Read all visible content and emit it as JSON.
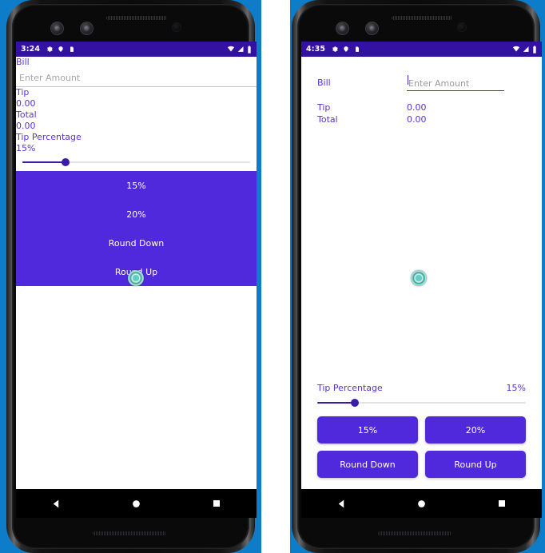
{
  "background_color": "#0d7cc9",
  "theme": {
    "status_bar": "#3312a3",
    "primary_text": "#5a33d6",
    "button_fill": "#5029dd",
    "slider_fill": "#3a1da8",
    "slider_track": "#e3e3e3",
    "touch_indicator": "#63cfc4"
  },
  "phones": [
    {
      "id": "left-phone-broken-layout",
      "status_bar": {
        "time": "3:24",
        "left_icons": [
          "gear-icon",
          "location-icon",
          "clipboard-icon"
        ],
        "right_icons": [
          "wifi-icon",
          "cellular-signal-icon",
          "battery-icon"
        ]
      },
      "app": {
        "bill_label": "Bill",
        "amount_placeholder": "Enter Amount",
        "amount_value": "",
        "tip_label": "Tip",
        "tip_value": "0.00",
        "total_label": "Total",
        "total_value": "0.00",
        "tip_percentage_label": "Tip Percentage",
        "tip_percentage_value": "15%",
        "slider_percent": 15,
        "buttons": [
          "15%",
          "20%",
          "Round Down",
          "Round Up"
        ]
      },
      "touch_indicator": {
        "visible": true,
        "over": "Round Up"
      },
      "nav_bar": [
        "back-icon",
        "home-icon",
        "recents-icon"
      ]
    },
    {
      "id": "right-phone-fixed-layout",
      "status_bar": {
        "time": "4:35",
        "left_icons": [
          "gear-icon",
          "location-icon",
          "clipboard-icon"
        ],
        "right_icons": [
          "wifi-icon",
          "cellular-signal-icon",
          "battery-icon"
        ]
      },
      "app": {
        "bill_label": "Bill",
        "amount_placeholder": "Enter Amount",
        "amount_value": "",
        "tip_label": "Tip",
        "tip_value": "0.00",
        "total_label": "Total",
        "total_value": "0.00",
        "tip_percentage_label": "Tip Percentage",
        "tip_percentage_value": "15%",
        "slider_percent": 15,
        "buttons": [
          "15%",
          "20%",
          "Round Down",
          "Round Up"
        ]
      },
      "touch_indicator": {
        "visible": true,
        "over": "canvas-center"
      },
      "nav_bar": [
        "back-icon",
        "home-icon",
        "recents-icon"
      ]
    }
  ]
}
